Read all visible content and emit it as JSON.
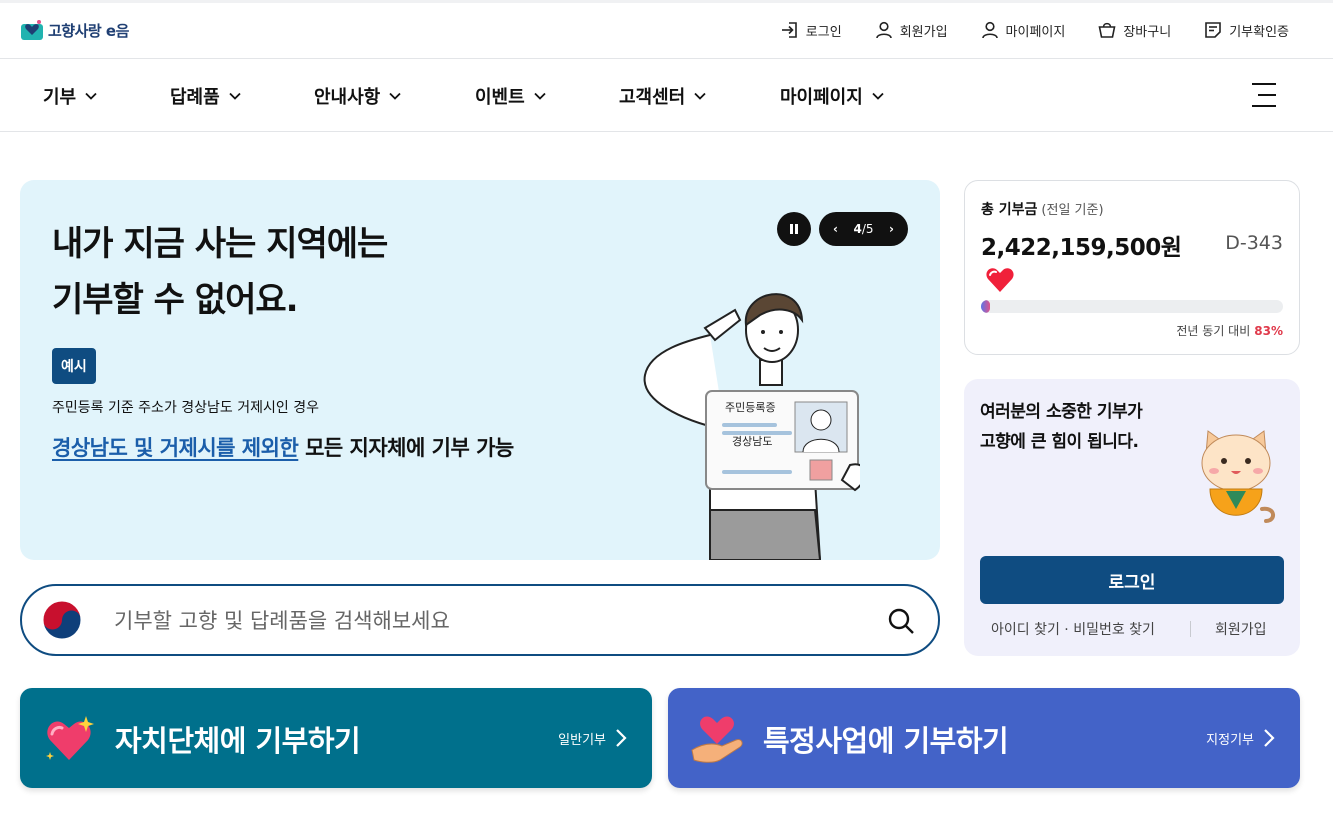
{
  "header": {
    "logo_text": "고향사랑 e음",
    "utils": [
      {
        "label": "로그인",
        "icon": "login-icon"
      },
      {
        "label": "회원가입",
        "icon": "user-icon"
      },
      {
        "label": "마이페이지",
        "icon": "user-icon"
      },
      {
        "label": "장바구니",
        "icon": "basket-icon"
      },
      {
        "label": "기부확인증",
        "icon": "certificate-icon"
      }
    ]
  },
  "nav": {
    "items": [
      "기부",
      "답례품",
      "안내사항",
      "이벤트",
      "고객센터",
      "마이페이지"
    ]
  },
  "banner": {
    "title_line1": "내가 지금 사는 지역에는",
    "title_line2": "기부할 수 없어요.",
    "badge": "예시",
    "subtitle": "주민등록 기준 주소가 경상남도 거제시인 경우",
    "highlight": "경상남도 및 거제시를 제외한",
    "rest": " 모든 지자체에 기부 가능",
    "card_title": "주민등록증",
    "card_region": "경상남도",
    "pager": {
      "current": "4",
      "total": "/5"
    }
  },
  "search": {
    "placeholder": "기부할 고향 및 답례품을 검색해보세요"
  },
  "donation": {
    "label": "총 기부금",
    "label_note": "(전일 기준)",
    "amount": "2,422,159,500원",
    "dday": "D-343",
    "progress_fraction": 0.03,
    "compare_label": "전년 동기 대비",
    "compare_value": "83%"
  },
  "login_box": {
    "message_line1": "여러분의 소중한 기부가",
    "message_line2": "고향에 큰 힘이 됩니다.",
    "button": "로그인",
    "find_link": "아이디 찾기 · 비밀번호 찾기",
    "join_link": "회원가입"
  },
  "cta": [
    {
      "title": "자치단체에 기부하기",
      "tag": "일반기부",
      "color": "#00708c"
    },
    {
      "title": "특정사업에 기부하기",
      "tag": "지정기부",
      "color": "#4363c8"
    }
  ],
  "colors": {
    "primary": "#0f4c81",
    "banner_bg": "#e1f4fb",
    "accent_red": "#e03a4b"
  }
}
